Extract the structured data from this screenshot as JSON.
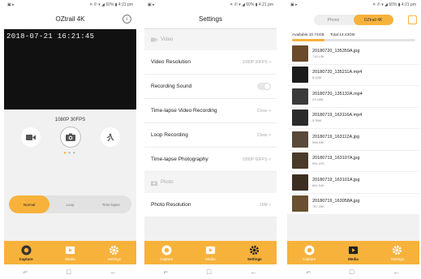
{
  "status": {
    "left": "▣ ▸",
    "right": "✕ ✆ ▾ ◢ 60% ▮ 4:21 pm"
  },
  "capture_screen": {
    "title": "OZtrail 4K",
    "info_label": "i",
    "timestamp": "2018-07-21 16:21:45",
    "resolution": "1080P 30FPS",
    "modes": [
      "video-icon",
      "camera-icon",
      "slow-motion-icon"
    ],
    "page_dots": "●●●",
    "segments": [
      "Normal",
      "Loop",
      "Time-lapse"
    ],
    "active_segment": "Normal"
  },
  "settings_screen": {
    "title": "Settings",
    "video_section": "Video",
    "photo_section": "Photo",
    "rows": {
      "video_resolution": {
        "label": "Video Resolution",
        "value": "1080P 30FPS >"
      },
      "recording_sound": {
        "label": "Recording Sound"
      },
      "timelapse_video": {
        "label": "Time-lapse Video Recording",
        "value": "Close >"
      },
      "loop_recording": {
        "label": "Loop Recording",
        "value": "Close >"
      },
      "timelapse_photo": {
        "label": "Time-lapse Photography",
        "value": "1080P 60FPS >"
      },
      "photo_resolution": {
        "label": "Photo Resolution",
        "value": "16M >"
      }
    }
  },
  "media_screen": {
    "segments": [
      "Phone",
      "OZtrail 4K"
    ],
    "active_segment": "OZtrail 4K",
    "available": "Available:10.74GB",
    "total": "Total:14.43GB",
    "used_fraction": 0.26,
    "files": [
      {
        "name": "20180720_135359A.jpg",
        "size": "715.13K"
      },
      {
        "name": "20180720_135211A.mp4",
        "size": "5.62M"
      },
      {
        "name": "20180720_135132A.mp4",
        "size": "23.16M"
      },
      {
        "name": "20180719_163116A.mp4",
        "size": "5.99M"
      },
      {
        "name": "20180719_163112A.jpg",
        "size": "958.93K"
      },
      {
        "name": "20180719_163107A.jpg",
        "size": "951.47K"
      },
      {
        "name": "20180719_163101A.jpg",
        "size": "662.94K"
      },
      {
        "name": "20180719_163058A.jpg",
        "size": "787.25K"
      }
    ]
  },
  "tabs": {
    "capture": "Capture",
    "media": "Media",
    "settings": "Settings"
  },
  "navbar": {
    "back": "←",
    "home": "□",
    "recents": "⌐"
  },
  "colors": {
    "accent": "#f7b23b"
  }
}
